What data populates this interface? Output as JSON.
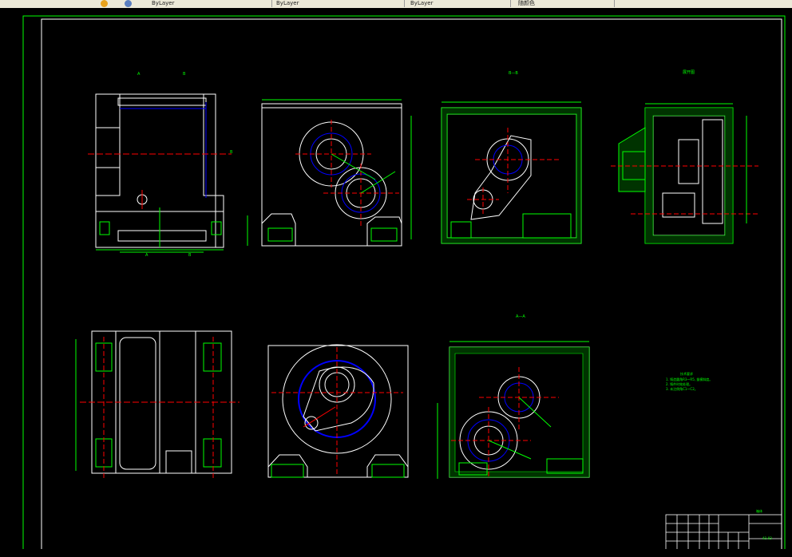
{
  "toolbar": {
    "cells": [
      "ByLayer",
      "ByLayer",
      "ByLayer",
      "随颜色"
    ],
    "colors": {
      "bg": "#ece9d8",
      "icon1": "#e8a21c",
      "icon2": "#5b7fbf"
    }
  },
  "drawing": {
    "view_labels": {
      "a1": "A",
      "b1": "B",
      "a2": "A",
      "b2": "B",
      "bb": "B",
      "section_bb": "B—B",
      "side_view": "展开图",
      "section_aa": "A—A"
    },
    "tech_requirements": {
      "title": "技术要求",
      "lines": [
        "1. 铸造圆角R3～R5, 拔模斜度。",
        "2. 铸件时效处理。",
        "3. 未注倒角C1～C2。"
      ]
    },
    "title_block": {
      "drawing_name": "箱体",
      "number": "A1-03"
    },
    "colors": {
      "outline": "#ffffff",
      "dim": "#00ff00",
      "center": "#ff0000",
      "hidden": "#0000ff",
      "frame": "#00ff00",
      "hatch": "#00ff00"
    }
  }
}
